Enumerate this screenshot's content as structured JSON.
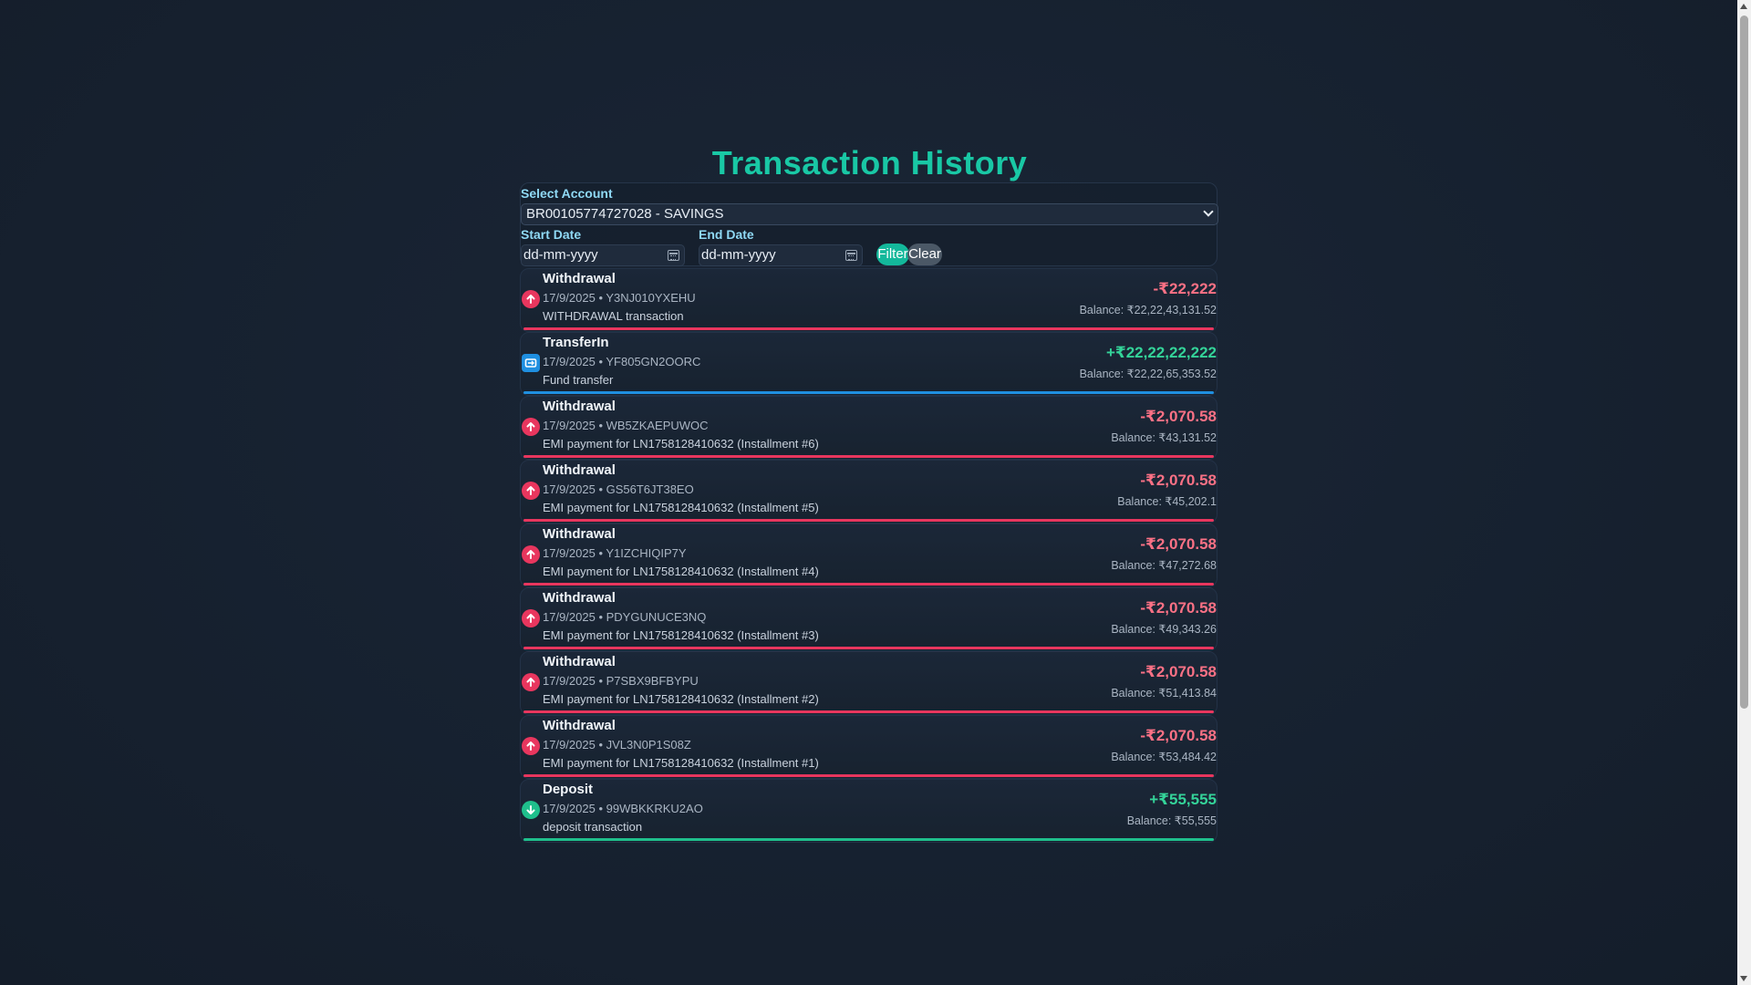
{
  "page": {
    "title": "Transaction History"
  },
  "filters": {
    "account_label": "Select Account",
    "account_value": "BR00105774727028 - SAVINGS",
    "start_label": "Start Date",
    "start_placeholder": "dd-mm-yyyy",
    "end_label": "End Date",
    "end_placeholder": "dd-mm-yyyy",
    "filter_button": "Filter",
    "clear_button": "Clear"
  },
  "transactions": [
    {
      "type": "Withdrawal",
      "meta": "17/9/2025 • Y3NJ010YXEHU",
      "desc": "WITHDRAWAL transaction",
      "amount": "-₹22,222",
      "balance": "Balance: ₹22,22,43,131.52",
      "kind": "withdraw"
    },
    {
      "type": "TransferIn",
      "meta": "17/9/2025 • YF805GN2OORC",
      "desc": "Fund transfer",
      "amount": "+₹22,22,22,222",
      "balance": "Balance: ₹22,22,65,353.52",
      "kind": "transfer"
    },
    {
      "type": "Withdrawal",
      "meta": "17/9/2025 • WB5ZKAEPUWOC",
      "desc": "EMI payment for LN1758128410632 (Installment #6)",
      "amount": "-₹2,070.58",
      "balance": "Balance: ₹43,131.52",
      "kind": "withdraw"
    },
    {
      "type": "Withdrawal",
      "meta": "17/9/2025 • GS56T6JT38EO",
      "desc": "EMI payment for LN1758128410632 (Installment #5)",
      "amount": "-₹2,070.58",
      "balance": "Balance: ₹45,202.1",
      "kind": "withdraw"
    },
    {
      "type": "Withdrawal",
      "meta": "17/9/2025 • Y1IZCHIQIP7Y",
      "desc": "EMI payment for LN1758128410632 (Installment #4)",
      "amount": "-₹2,070.58",
      "balance": "Balance: ₹47,272.68",
      "kind": "withdraw"
    },
    {
      "type": "Withdrawal",
      "meta": "17/9/2025 • PDYGUNUCE3NQ",
      "desc": "EMI payment for LN1758128410632 (Installment #3)",
      "amount": "-₹2,070.58",
      "balance": "Balance: ₹49,343.26",
      "kind": "withdraw"
    },
    {
      "type": "Withdrawal",
      "meta": "17/9/2025 • P7SBX9BFBYPU",
      "desc": "EMI payment for LN1758128410632 (Installment #2)",
      "amount": "-₹2,070.58",
      "balance": "Balance: ₹51,413.84",
      "kind": "withdraw"
    },
    {
      "type": "Withdrawal",
      "meta": "17/9/2025 • JVL3N0P1S08Z",
      "desc": "EMI payment for LN1758128410632 (Installment #1)",
      "amount": "-₹2,070.58",
      "balance": "Balance: ₹53,484.42",
      "kind": "withdraw"
    },
    {
      "type": "Deposit",
      "meta": "17/9/2025 • 99WBKKRKU2AO",
      "desc": "deposit transaction",
      "amount": "+₹55,555",
      "balance": "Balance: ₹55,555",
      "kind": "deposit"
    }
  ],
  "colors": {
    "accent": "#19c8a5",
    "withdraw": "#e8365e",
    "deposit": "#1fbf8c",
    "transfer": "#1f8fe0",
    "negative_amount": "#fb7185",
    "positive_amount": "#34d399"
  },
  "icons": {
    "withdraw": "arrow-up-circle-icon",
    "transfer": "transfer-icon",
    "deposit": "arrow-down-circle-icon"
  }
}
